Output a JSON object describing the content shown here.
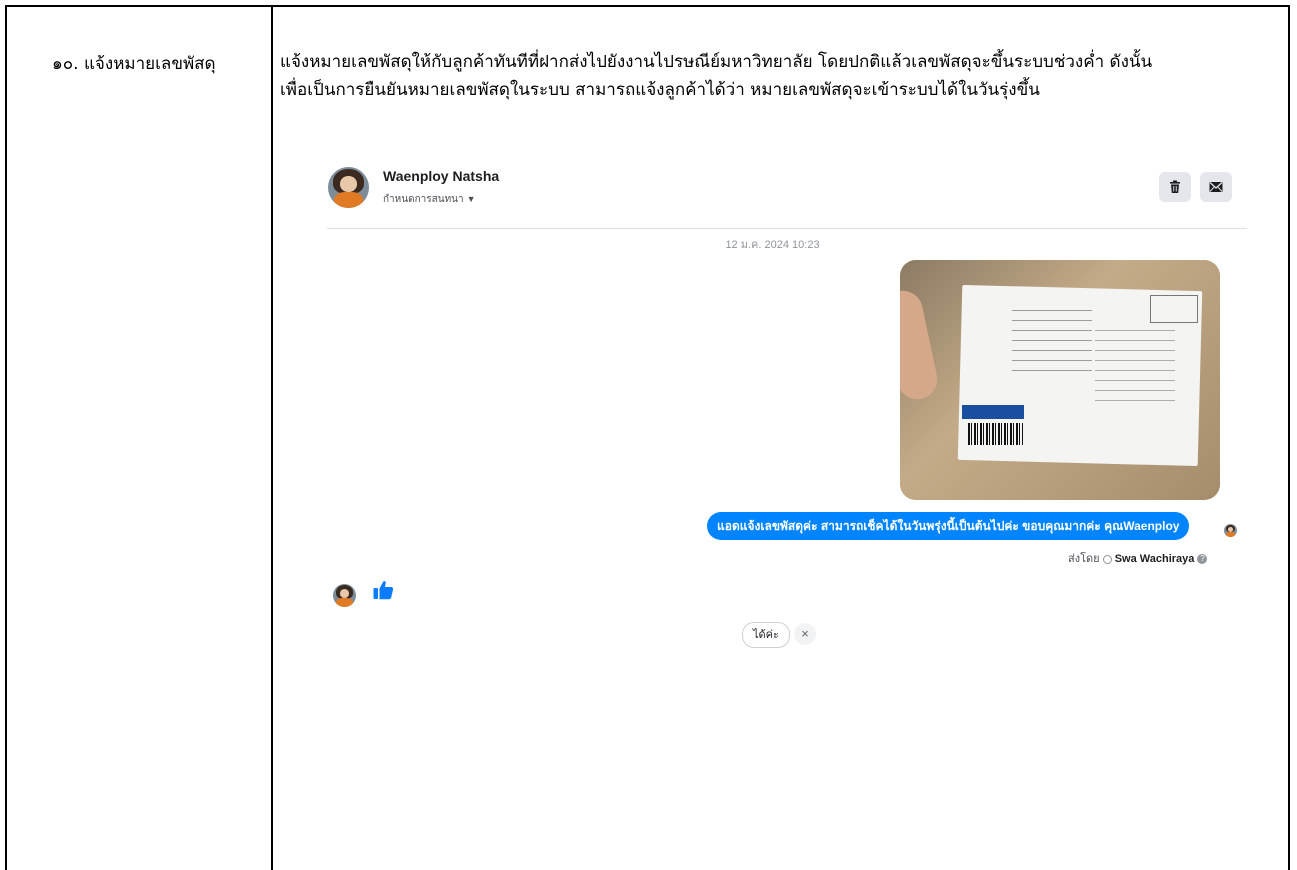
{
  "row": {
    "label": "๑๐. แจ้งหมายเลขพัสดุ",
    "description": [
      "แจ้งหมายเลขพัสดุให้กับลูกค้าทันทีที่ฝากส่งไปยังงานไปรษณีย์มหาวิทยาลัย โดยปกติแล้วเลขพัสดุจะขึ้นระบบช่วงค่ำ ดังนั้น",
      "เพื่อเป็นการยืนยันหมายเลขพัสดุในระบบ สามารถแจ้งลูกค้าได้ว่า หมายเลขพัสดุจะเข้าระบบได้ในวันรุ่งขึ้น"
    ]
  },
  "chat": {
    "contact_name": "Waenploy Natsha",
    "contact_subtitle": "กำหนดการสนทนา",
    "timestamp": "12 ม.ค. 2024 10:23",
    "message": "แอดแจ้งเลขพัสดุค่ะ สามารถเช็คได้ในวันพรุ่งนี้เป็นต้นไปค่ะ ขอบคุณมากค่ะ คุณWaenploy",
    "sent_by_prefix": "ส่งโดย",
    "sent_by_name": "Swa Wachiraya",
    "quick_reply": "ได้ค่ะ",
    "icons": {
      "delete": "trash-icon",
      "mail": "envelope-icon",
      "like": "thumbs-up-icon",
      "close": "close-icon",
      "caret": "caret-down-icon",
      "help": "question-icon"
    },
    "colors": {
      "bubble": "#0084ff",
      "like": "#0a7cff"
    }
  }
}
